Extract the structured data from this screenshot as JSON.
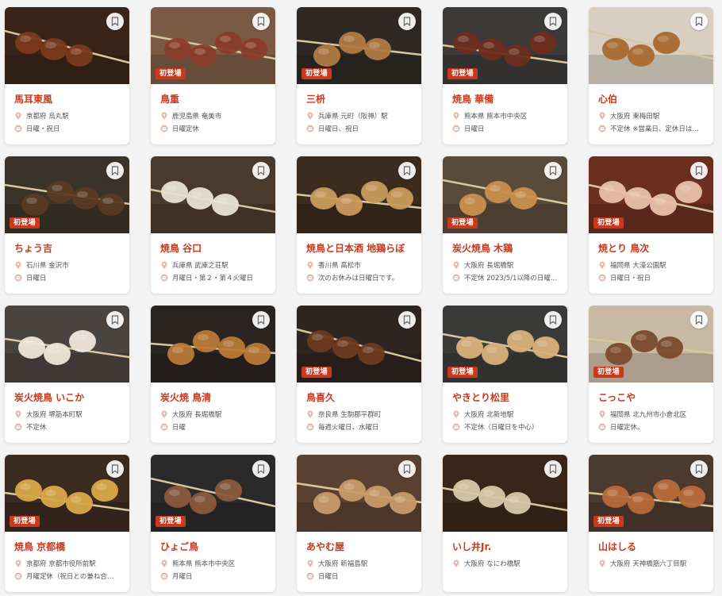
{
  "badge_label": "初登場",
  "colors": {
    "accent": "#c8391d",
    "icon": "#e9b5a7"
  },
  "icons": {
    "bookmark": "bookmark-icon",
    "location": "location-pin-icon",
    "closed": "calendar-closed-icon"
  },
  "shops": [
    {
      "name": "馬耳東風",
      "location": "京都府 烏丸駅",
      "holiday": "日曜・祝日",
      "new": false,
      "bg": "#3a2418",
      "skewer": "#7a3a1c"
    },
    {
      "name": "鳥重",
      "location": "鹿児島県 奄美市",
      "holiday": "日曜定休",
      "new": true,
      "bg": "#7a5a43",
      "skewer": "#8a3d2a"
    },
    {
      "name": "三枡",
      "location": "兵庫県 元町（阪神）駅",
      "holiday": "日曜日、祝日",
      "new": true,
      "bg": "#2d2824",
      "skewer": "#b07a45"
    },
    {
      "name": "焼鳥 華備",
      "location": "熊本県 熊本市中央区",
      "holiday": "日曜日",
      "new": true,
      "bg": "#3b3a39",
      "skewer": "#6b2d1c"
    },
    {
      "name": "心伯",
      "location": "大阪府 東梅田駅",
      "holiday": "不定休 ※営業日、定休日は…",
      "new": false,
      "bg": "#d8cfc2",
      "skewer": "#a8692e"
    },
    {
      "name": "ちょう吉",
      "location": "石川県 金沢市",
      "holiday": "日曜日",
      "new": true,
      "bg": "#3a3329",
      "skewer": "#5a3a23"
    },
    {
      "name": "焼鳥 谷口",
      "location": "兵庫県 武庫之荘駅",
      "holiday": "月曜日・第２・第４火曜日",
      "new": false,
      "bg": "#4a3a2c",
      "skewer": "#e8e0d2"
    },
    {
      "name": "焼鳥と日本酒 地鶏らぼ",
      "location": "香川県 高松市",
      "holiday": "次のお休みは日曜日です。",
      "new": false,
      "bg": "#3b2a1e",
      "skewer": "#c99a5c"
    },
    {
      "name": "炭火焼鳥 木鶏",
      "location": "大阪府 長堀橋駅",
      "holiday": "不定休 2023/5/1以降の日曜…",
      "new": true,
      "bg": "#5a4a3a",
      "skewer": "#c98f4e"
    },
    {
      "name": "焼とり 鳥次",
      "location": "福岡県 大濠公園駅",
      "holiday": "日曜日・祝日",
      "new": true,
      "bg": "#6b2e1f",
      "skewer": "#e8c0a8"
    },
    {
      "name": "炭火焼鳥 いこか",
      "location": "大阪府 堺筋本町駅",
      "holiday": "不定休",
      "new": false,
      "bg": "#4a4440",
      "skewer": "#efe6da"
    },
    {
      "name": "炭火焼 鳥清",
      "location": "大阪府 長堀橋駅",
      "holiday": "日曜",
      "new": false,
      "bg": "#2a2420",
      "skewer": "#b87a38"
    },
    {
      "name": "鳥喜久",
      "location": "奈良県 生駒郡平群町",
      "holiday": "毎週火曜日、水曜日",
      "new": true,
      "bg": "#2e2420",
      "skewer": "#6b3a20"
    },
    {
      "name": "やきとり松里",
      "location": "大阪府 北新地駅",
      "holiday": "不定休（日曜日を中心）",
      "new": true,
      "bg": "#3a3a38",
      "skewer": "#d8b07a"
    },
    {
      "name": "こっこや",
      "location": "福岡県 北九州市小倉北区",
      "holiday": "日曜定休。",
      "new": true,
      "bg": "#c9b8a4",
      "skewer": "#7a4a2e"
    },
    {
      "name": "焼鳥 京都橋",
      "location": "京都府 京都市役所前駅",
      "holiday": "月曜定休（祝日との兼ね合…",
      "new": true,
      "bg": "#3a2a20",
      "skewer": "#d8a848"
    },
    {
      "name": "ひょご鳥",
      "location": "熊本県 熊本市中央区",
      "holiday": "月曜日",
      "new": true,
      "bg": "#2a2a2a",
      "skewer": "#8a5a3e"
    },
    {
      "name": "あやむ屋",
      "location": "大阪府 新福島駅",
      "holiday": "日曜日",
      "new": false,
      "bg": "#5a4030",
      "skewer": "#c89a6a"
    },
    {
      "name": "いし井Jr.",
      "location": "大阪府 なにわ橋駅",
      "holiday": "",
      "new": false,
      "bg": "#3a2618",
      "skewer": "#d8c8a8"
    },
    {
      "name": "山はしる",
      "location": "大阪府 天神橋筋六丁目駅",
      "holiday": "",
      "new": true,
      "bg": "#4a3a30",
      "skewer": "#b86a3a"
    }
  ]
}
